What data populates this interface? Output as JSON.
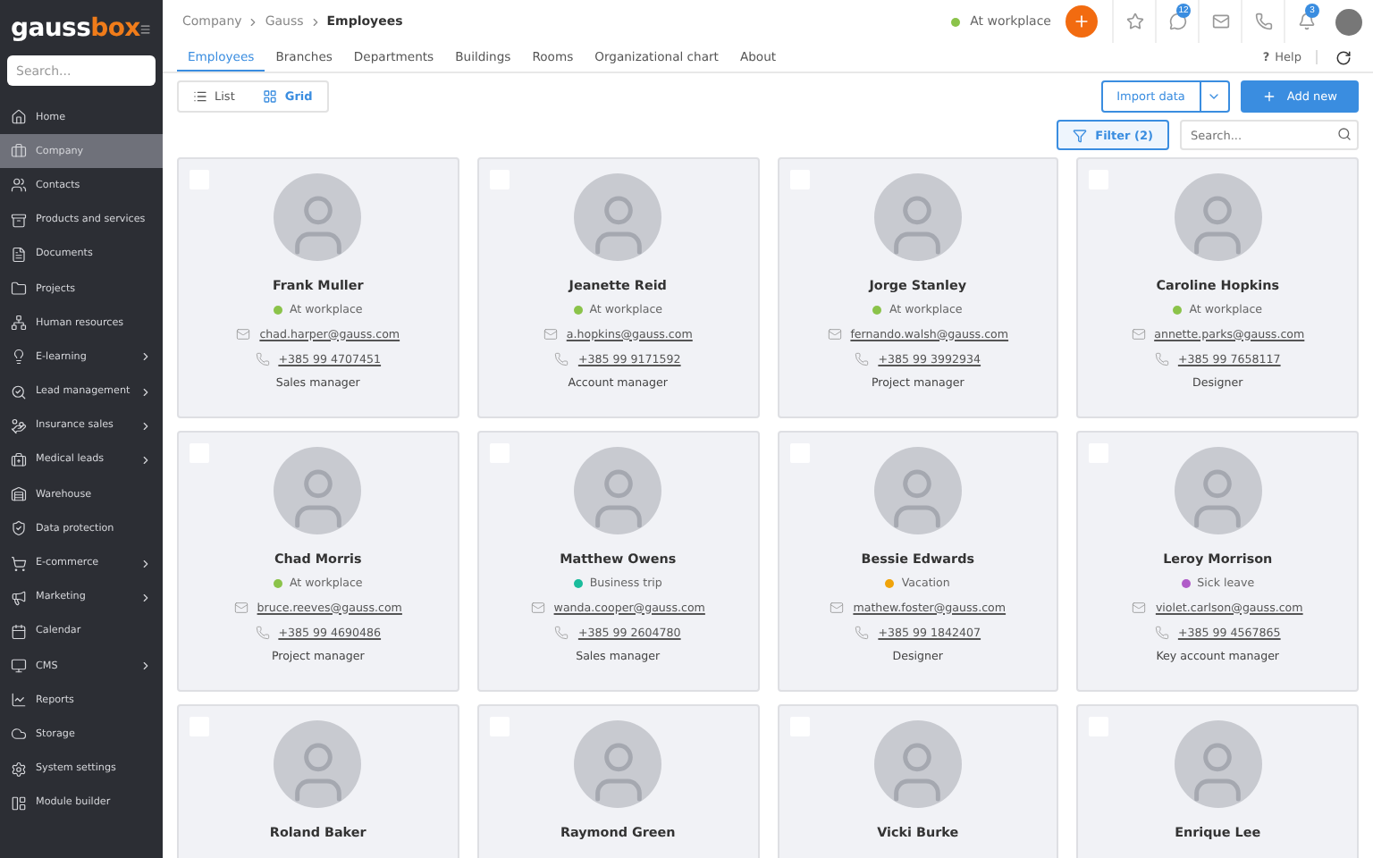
{
  "sidebar": {
    "logo": {
      "main": "gauss",
      "accent": "box"
    },
    "search": {
      "placeholder": "Search..."
    },
    "items": [
      {
        "label": "Home",
        "selected": false,
        "expandable": false
      },
      {
        "label": "Company",
        "selected": true,
        "expandable": false
      },
      {
        "label": "Contacts",
        "selected": false,
        "expandable": false
      },
      {
        "label": "Products and services",
        "selected": false,
        "expandable": false
      },
      {
        "label": "Documents",
        "selected": false,
        "expandable": false
      },
      {
        "label": "Projects",
        "selected": false,
        "expandable": false
      },
      {
        "label": "Human resources",
        "selected": false,
        "expandable": false
      },
      {
        "label": "E-learning",
        "selected": false,
        "expandable": true
      },
      {
        "label": "Lead management",
        "selected": false,
        "expandable": true
      },
      {
        "label": "Insurance sales",
        "selected": false,
        "expandable": true
      },
      {
        "label": "Medical leads",
        "selected": false,
        "expandable": true
      },
      {
        "label": "Warehouse",
        "selected": false,
        "expandable": false
      },
      {
        "label": "Data protection",
        "selected": false,
        "expandable": false
      },
      {
        "label": "E-commerce",
        "selected": false,
        "expandable": true
      },
      {
        "label": "Marketing",
        "selected": false,
        "expandable": true
      },
      {
        "label": "Calendar",
        "selected": false,
        "expandable": false
      },
      {
        "label": "CMS",
        "selected": false,
        "expandable": true
      },
      {
        "label": "Reports",
        "selected": false,
        "expandable": false
      },
      {
        "label": "Storage",
        "selected": false,
        "expandable": false
      },
      {
        "label": "System settings",
        "selected": false,
        "expandable": false
      },
      {
        "label": "Module builder",
        "selected": false,
        "expandable": false
      }
    ]
  },
  "breadcrumb": [
    "Company",
    "Gauss",
    "Employees"
  ],
  "header": {
    "status": {
      "label": "At workplace",
      "color": "#8bc34a"
    },
    "messages_badge": "12",
    "notifications_badge": "3"
  },
  "tabs": [
    {
      "label": "Employees",
      "selected": true
    },
    {
      "label": "Branches",
      "selected": false
    },
    {
      "label": "Departments",
      "selected": false
    },
    {
      "label": "Buildings",
      "selected": false
    },
    {
      "label": "Rooms",
      "selected": false
    },
    {
      "label": "Organizational chart",
      "selected": false
    },
    {
      "label": "About",
      "selected": false
    }
  ],
  "help": {
    "icon": "?",
    "label": "Help"
  },
  "view_toggle": [
    {
      "label": "List",
      "selected": false
    },
    {
      "label": "Grid",
      "selected": true
    }
  ],
  "import_button": "Import data",
  "add_button": "Add new",
  "filter_button": "Filter (2)",
  "search": {
    "placeholder": "Search..."
  },
  "employees": [
    {
      "name": "Frank Muller",
      "status": "At workplace",
      "color": "#8bc34a",
      "email": "chad.harper@gauss.com",
      "phone": "+385 99 4707451",
      "role": "Sales manager",
      "checked": false
    },
    {
      "name": "Jeanette Reid",
      "status": "At workplace",
      "color": "#8bc34a",
      "email": "a.hopkins@gauss.com",
      "phone": "+385 99 9171592",
      "role": "Account manager",
      "checked": false
    },
    {
      "name": "Jorge Stanley",
      "status": "At workplace",
      "color": "#8bc34a",
      "email": "fernando.walsh@gauss.com",
      "phone": "+385 99 3992934",
      "role": "Project manager",
      "checked": false
    },
    {
      "name": "Caroline Hopkins",
      "status": "At workplace",
      "color": "#8bc34a",
      "email": "annette.parks@gauss.com",
      "phone": "+385 99 7658117",
      "role": "Designer",
      "checked": false
    },
    {
      "name": "Chad Morris",
      "status": "At workplace",
      "color": "#8bc34a",
      "email": "bruce.reeves@gauss.com",
      "phone": "+385 99 4690486",
      "role": "Project manager",
      "checked": false
    },
    {
      "name": "Matthew Owens",
      "status": "Business trip",
      "color": "#1abc9c",
      "email": "wanda.cooper@gauss.com",
      "phone": "+385 99 2604780",
      "role": "Sales manager",
      "checked": false
    },
    {
      "name": "Bessie Edwards",
      "status": "Vacation",
      "color": "#f0a30a",
      "email": "mathew.foster@gauss.com",
      "phone": "+385 99 1842407",
      "role": "Designer",
      "checked": false
    },
    {
      "name": "Leroy Morrison",
      "status": "Sick leave",
      "color": "#b05cc8",
      "email": "violet.carlson@gauss.com",
      "phone": "+385 99 4567865",
      "role": "Key account manager",
      "checked": false
    },
    {
      "name": "Roland Baker",
      "checked": false
    },
    {
      "name": "Raymond Green",
      "checked": false
    },
    {
      "name": "Vicki Burke",
      "checked": false
    },
    {
      "name": "Enrique Lee",
      "checked": false
    }
  ]
}
